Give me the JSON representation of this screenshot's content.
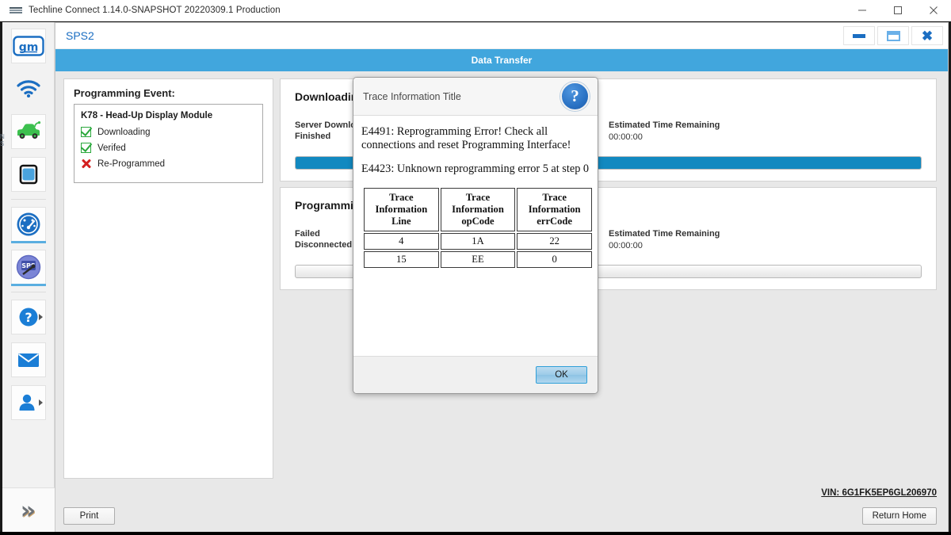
{
  "os_window": {
    "title": "Techline Connect 1.14.0-SNAPSHOT 20220309.1 Production",
    "icon": "app-logo-icon",
    "minimize_label": "─",
    "maximize_label": "□",
    "close_label": "✕"
  },
  "sidebar": {
    "items": [
      {
        "name": "gm-logo-icon",
        "label": "gm"
      },
      {
        "name": "wifi-icon",
        "label": ""
      },
      {
        "name": "vehicle-icon",
        "label": ""
      },
      {
        "name": "device-icon",
        "label": ""
      },
      {
        "name": "diagnostics-gauge-icon",
        "label": ""
      },
      {
        "name": "sps-icon",
        "label": "SPS"
      },
      {
        "name": "help-icon",
        "label": ""
      },
      {
        "name": "mail-icon",
        "label": ""
      },
      {
        "name": "user-icon",
        "label": ""
      }
    ],
    "collapse_label": "»",
    "ghost_text_line1": "N",
    "ghost_text_line2": "S"
  },
  "sps": {
    "title": "SPS2",
    "minimize_label": "",
    "maximize_label": "",
    "close_label": "✖",
    "banner": "Data Transfer"
  },
  "programming_event": {
    "title": "Programming Event:",
    "module": "K78 - Head-Up Display Module",
    "statuses": [
      {
        "label": "Downloading",
        "state": "ok"
      },
      {
        "label": "Verifed",
        "state": "ok"
      },
      {
        "label": "Re-Programmed",
        "state": "fail"
      }
    ]
  },
  "stages": [
    {
      "title": "Downloading",
      "status": "Server Download\nFinished",
      "eta_label": "Estimated Time Remaining",
      "eta_value": "00:00:00",
      "progress_percent": 100
    },
    {
      "title": "Programming",
      "status": "Failed\nDisconnected",
      "eta_label": "Estimated Time Remaining",
      "eta_value": "00:00:00",
      "progress_percent": 0
    }
  ],
  "footer": {
    "vin": "VIN: 6G1FK5EP6GL206970",
    "print_label": "Print",
    "return_home_label": "Return Home"
  },
  "dialog": {
    "title": "Trace Information Title",
    "help_icon_label": "?",
    "messages": [
      "E4491: Reprogramming Error! Check all connections and reset Programming Interface!",
      "E4423: Unknown reprogramming error 5 at step 0"
    ],
    "table": {
      "headers": [
        "Trace Information Line",
        "Trace Information opCode",
        "Trace Information errCode"
      ],
      "rows": [
        [
          "4",
          "1A",
          "22"
        ],
        [
          "15",
          "EE",
          "0"
        ]
      ]
    },
    "ok_label": "OK"
  },
  "colors": {
    "accent_blue": "#41a6dd",
    "progress_blue": "#1289c0",
    "gm_blue": "#1b6ec2",
    "success_green": "#2aa83c",
    "error_red": "#d42020"
  }
}
